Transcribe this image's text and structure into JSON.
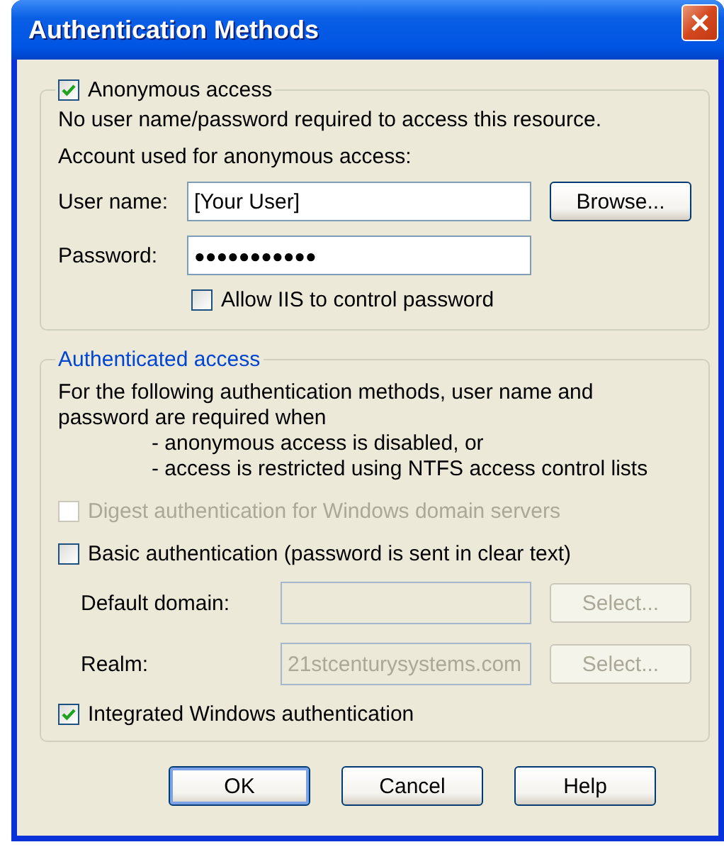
{
  "window": {
    "title": "Authentication Methods"
  },
  "anonymous_access": {
    "checkbox": {
      "label": "Anonymous access",
      "checked": true
    },
    "description": "No user name/password required to access this resource.",
    "account_caption": "Account used for anonymous access:",
    "user_name": {
      "label": "User name:",
      "value": "[Your User]"
    },
    "browse_button": "Browse...",
    "password": {
      "label": "Password:",
      "value": "●●●●●●●●●●●"
    },
    "allow_iis": {
      "label": "Allow IIS to control password",
      "checked": false
    }
  },
  "authenticated_access": {
    "title": "Authenticated access",
    "description": "For the following authentication methods, user name and password are required when",
    "conditions": [
      "- anonymous access is disabled, or",
      "- access is restricted using NTFS access control lists"
    ],
    "methods": [
      {
        "kind": "checkbox",
        "label": "Digest authentication for Windows domain servers",
        "checked": false,
        "disabled": true
      },
      {
        "kind": "checkbox",
        "label": "Basic authentication (password is sent in clear text)",
        "checked": false,
        "disabled": false
      },
      {
        "kind": "field",
        "label": "Default domain:",
        "disabled": true,
        "button": "Select..."
      },
      {
        "kind": "field",
        "label": "Realm:",
        "value": "21stcenturysystems.com",
        "disabled": true,
        "button": "Select..."
      },
      {
        "kind": "checkbox",
        "label": "Integrated Windows authentication",
        "checked": true,
        "disabled": false
      }
    ]
  },
  "buttons": [
    {
      "label": "OK",
      "default": true
    },
    {
      "label": "Cancel",
      "default": false
    },
    {
      "label": "Help",
      "default": false
    }
  ]
}
